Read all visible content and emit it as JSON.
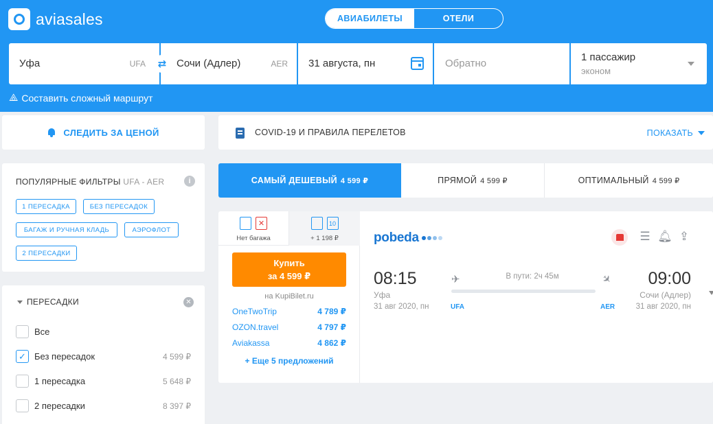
{
  "header": {
    "logo_text": "aviasales",
    "tabs": [
      {
        "label": "АВИАБИЛЕТЫ",
        "active": true
      },
      {
        "label": "ОТЕЛИ",
        "active": false
      }
    ],
    "accent_color": "#2196f3"
  },
  "search": {
    "origin": {
      "city": "Уфа",
      "code": "UFA"
    },
    "destination": {
      "city": "Сочи (Адлер)",
      "code": "AER"
    },
    "depart_date": "31 августа, пн",
    "return_placeholder": "Обратно",
    "passengers": "1 пассажир",
    "cabin_class": "эконом",
    "swap_icon": "swap-icon",
    "calendar_icon": "calendar-icon"
  },
  "complex_route_link": "Составить сложный маршрут",
  "price_alert": {
    "label": "СЛЕДИТЬ ЗА ЦЕНОЙ",
    "icon": "bell-icon"
  },
  "covid": {
    "label": "COVID-19 И ПРАВИЛА ПЕРЕЛЕТОВ",
    "show_label": "ПОКАЗАТЬ"
  },
  "popular_filters": {
    "title": "ПОПУЛЯРНЫЕ ФИЛЬТРЫ",
    "route": "UFA - AER",
    "chips": [
      "1 ПЕРЕСАДКА",
      "БЕЗ ПЕРЕСАДОК",
      "БАГАЖ И РУЧНАЯ КЛАДЬ",
      "АЭРОФЛОТ",
      "2 ПЕРЕСАДКИ"
    ]
  },
  "transfers_filter": {
    "title": "ПЕРЕСАДКИ",
    "options": [
      {
        "label": "Все",
        "price": "",
        "checked": false
      },
      {
        "label": "Без пересадок",
        "price": "4 599 ₽",
        "checked": true
      },
      {
        "label": "1 пересадка",
        "price": "5 648 ₽",
        "checked": false
      },
      {
        "label": "2 пересадки",
        "price": "8 397 ₽",
        "checked": false
      }
    ]
  },
  "sort_tabs": [
    {
      "label": "САМЫЙ ДЕШЕВЫЙ",
      "price": "4 599 ₽",
      "active": true
    },
    {
      "label": "ПРЯМОЙ",
      "price": "4 599 ₽",
      "active": false
    },
    {
      "label": "ОПТИМАЛЬНЫЙ",
      "price": "4 599 ₽",
      "active": false
    }
  ],
  "ticket": {
    "baggage_options": [
      {
        "label": "Нет багажа",
        "badge": ""
      },
      {
        "label": "+ 1 198 ₽",
        "badge": "10"
      }
    ],
    "buy_line1": "Купить",
    "buy_line2": "за 4 599 ₽",
    "seller": "на KupiBilet.ru",
    "agencies": [
      {
        "name": "OneTwoTrip",
        "price": "4 789 ₽"
      },
      {
        "name": "OZON.travel",
        "price": "4 797 ₽"
      },
      {
        "name": "Aviakassa",
        "price": "4 862 ₽"
      }
    ],
    "more_offers": "+ Еще 5 предложений",
    "airline": "pobeda",
    "departure": {
      "time": "08:15",
      "city": "Уфа",
      "date": "31 авг 2020, пн",
      "code": "UFA"
    },
    "arrival": {
      "time": "09:00",
      "city": "Сочи (Адлер)",
      "date": "31 авг 2020, пн",
      "code": "AER"
    },
    "duration": "В пути: 2ч 45м"
  }
}
